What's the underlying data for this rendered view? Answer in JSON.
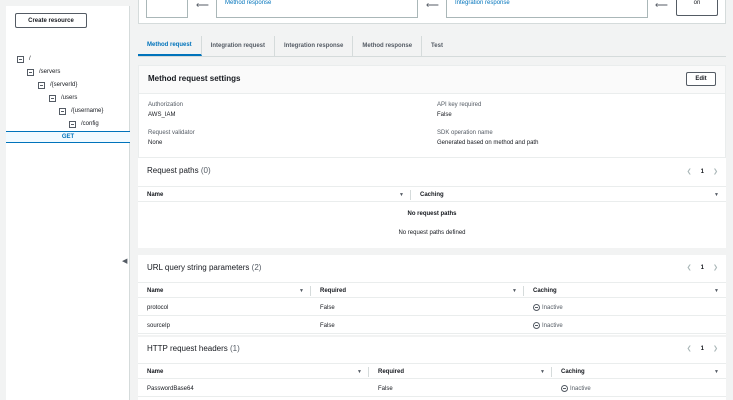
{
  "left_panel": {
    "create_resource_label": "Create resource",
    "tree": [
      {
        "label": "/"
      },
      {
        "label": "/servers"
      },
      {
        "label": "/{serverId}"
      },
      {
        "label": "/users"
      },
      {
        "label": "/{username}"
      },
      {
        "label": "/config"
      }
    ],
    "selected_method": "GET"
  },
  "flow": {
    "method_response": "Method response",
    "integration_response": "Integration response",
    "button_label": "on"
  },
  "tabs": [
    "Method request",
    "Integration request",
    "Integration response",
    "Method response",
    "Test"
  ],
  "settings": {
    "title": "Method request settings",
    "edit_label": "Edit",
    "authorization_label": "Authorization",
    "authorization_value": "AWS_IAM",
    "api_key_label": "API key required",
    "api_key_value": "False",
    "validator_label": "Request validator",
    "validator_value": "None",
    "sdk_label": "SDK operation name",
    "sdk_value": "Generated based on method and path"
  },
  "request_paths": {
    "title": "Request paths",
    "count": "(0)",
    "page": "1",
    "columns": [
      "Name",
      "Caching"
    ],
    "empty_title": "No request paths",
    "empty_sub": "No request paths defined"
  },
  "query_params": {
    "title": "URL query string parameters",
    "count": "(2)",
    "page": "1",
    "columns": [
      "Name",
      "Required",
      "Caching"
    ],
    "rows": [
      {
        "name": "protocol",
        "required": "False",
        "caching": "Inactive"
      },
      {
        "name": "sourceIp",
        "required": "False",
        "caching": "Inactive"
      }
    ]
  },
  "headers": {
    "title": "HTTP request headers",
    "count": "(1)",
    "page": "1",
    "columns": [
      "Name",
      "Required",
      "Caching"
    ],
    "rows": [
      {
        "name": "PasswordBase64",
        "required": "False",
        "caching": "Inactive"
      }
    ]
  }
}
